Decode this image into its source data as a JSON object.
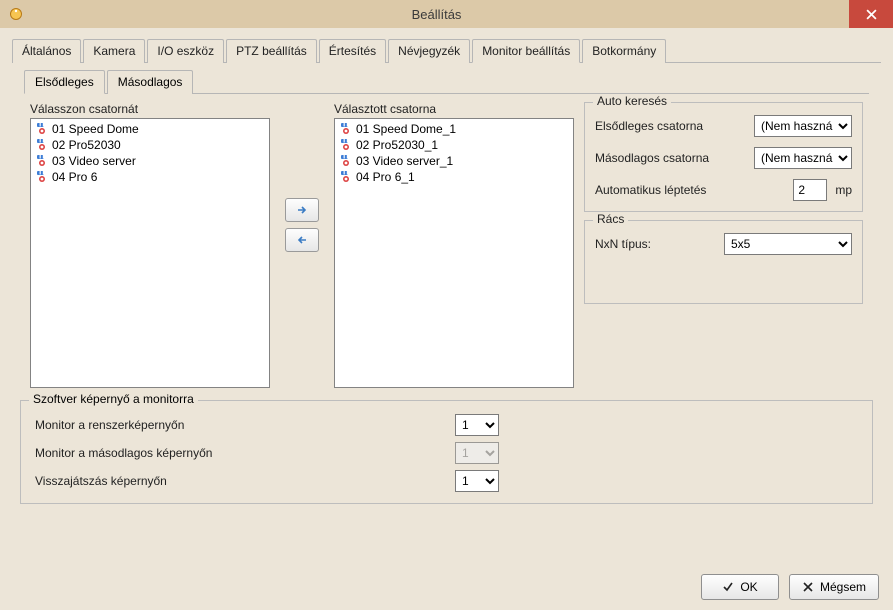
{
  "window": {
    "title": "Beállítás"
  },
  "tabs": {
    "main": [
      "Általános",
      "Kamera",
      "I/O eszköz",
      "PTZ beállítás",
      "Értesítés",
      "Névjegyzék",
      "Monitor beállítás",
      "Botkormány"
    ],
    "main_active": 6,
    "sub": [
      "Elsődleges",
      "Másodlagos"
    ],
    "sub_active": 0
  },
  "labels": {
    "available": "Válasszon csatornát",
    "selected": "Választott csatorna",
    "auto_search": "Auto keresés",
    "primary_channel": "Elsődleges csatorna",
    "secondary_channel": "Másodlagos csatorna",
    "auto_step": "Automatikus léptetés",
    "sec_unit": "mp",
    "grid": "Rács",
    "grid_type": "NxN típus:",
    "software_screen": "Szoftver képernyő a monitorra",
    "mon_sys": "Monitor a renszerképernyőn",
    "mon_sec": "Monitor a másodlagos képernyőn",
    "playback": "Visszajátszás képernyőn"
  },
  "channels": {
    "available": [
      "01 Speed Dome",
      "02 Pro52030",
      "03 Video server",
      "04 Pro 6"
    ],
    "selected": [
      "01 Speed Dome_1",
      "02 Pro52030_1",
      "03 Video server_1",
      "04 Pro 6_1"
    ]
  },
  "auto_search": {
    "primary_value": "(Nem használ",
    "secondary_value": "(Nem használ",
    "step_value": "2"
  },
  "grid_value": "5x5",
  "software": {
    "mon_sys_value": "1",
    "mon_sec_value": "1",
    "playback_value": "1"
  },
  "buttons": {
    "ok": "OK",
    "cancel": "Mégsem"
  }
}
